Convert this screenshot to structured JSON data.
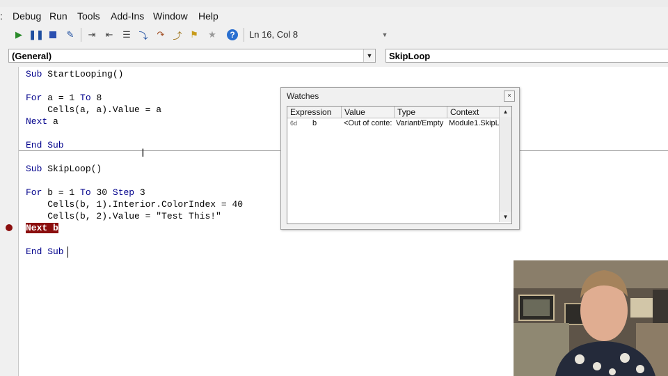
{
  "menu": [
    "Debug",
    "Run",
    "Tools",
    "Add-Ins",
    "Window",
    "Help"
  ],
  "toolbar": {
    "status": "Ln 16, Col 8",
    "icons": [
      "run-icon",
      "break-icon",
      "reset-icon",
      "design-mode-icon",
      "indent-icon",
      "outdent-icon",
      "toggle-breakpoint-icon",
      "step-into-icon",
      "step-over-icon",
      "step-out-icon",
      "bookmark-icon",
      "help-icon"
    ]
  },
  "dropdowns": {
    "object": "(General)",
    "procedure": "SkipLoop"
  },
  "code": {
    "l1": "StartLooping()",
    "l2a": "a = 1",
    "l2b": "8",
    "l3": "    Cells(a, a).Value = a",
    "l4": "a",
    "l5a": "b = 1",
    "l5b": "30",
    "l5c": "3",
    "l6": "SkipLoop()",
    "l7": "    Cells(b, 1).Interior.ColorIndex = 40",
    "l8": "    Cells(b, 2).Value = \"Test This!\"",
    "l9": "Next b",
    "kw_sub": "Sub",
    "kw_end_sub": "End Sub",
    "kw_for": "For",
    "kw_to": "To",
    "kw_step": "Step",
    "kw_next": "Next"
  },
  "watches": {
    "title": "Watches",
    "close_glyph": "×",
    "columns": [
      "Expression",
      "Value",
      "Type",
      "Context"
    ],
    "row": {
      "icon": "6d",
      "expression": "b",
      "value": "<Out of conte:",
      "type": "Variant/Empty",
      "context": "Module1.SkipL"
    }
  },
  "colors": {
    "keyword": "#00008b",
    "breakpoint": "#8b0e0e"
  }
}
